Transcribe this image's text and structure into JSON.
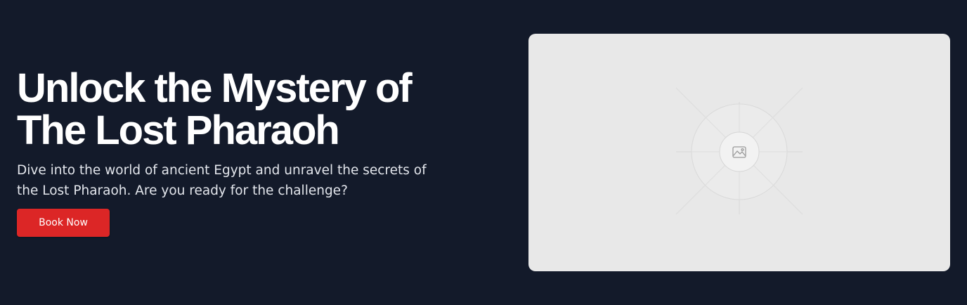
{
  "hero": {
    "title_line1": "Unlock the Mystery of",
    "title_line2": "The Lost Pharaoh",
    "subtitle": "Dive into the world of ancient Egypt and unravel the secrets of the Lost Pharaoh. Are you ready for the challenge?",
    "cta_label": "Book Now"
  },
  "image_placeholder": {
    "icon": "image-icon"
  },
  "colors": {
    "background": "#131a2a",
    "button": "#dc2626",
    "placeholder": "#e8e8e8"
  }
}
